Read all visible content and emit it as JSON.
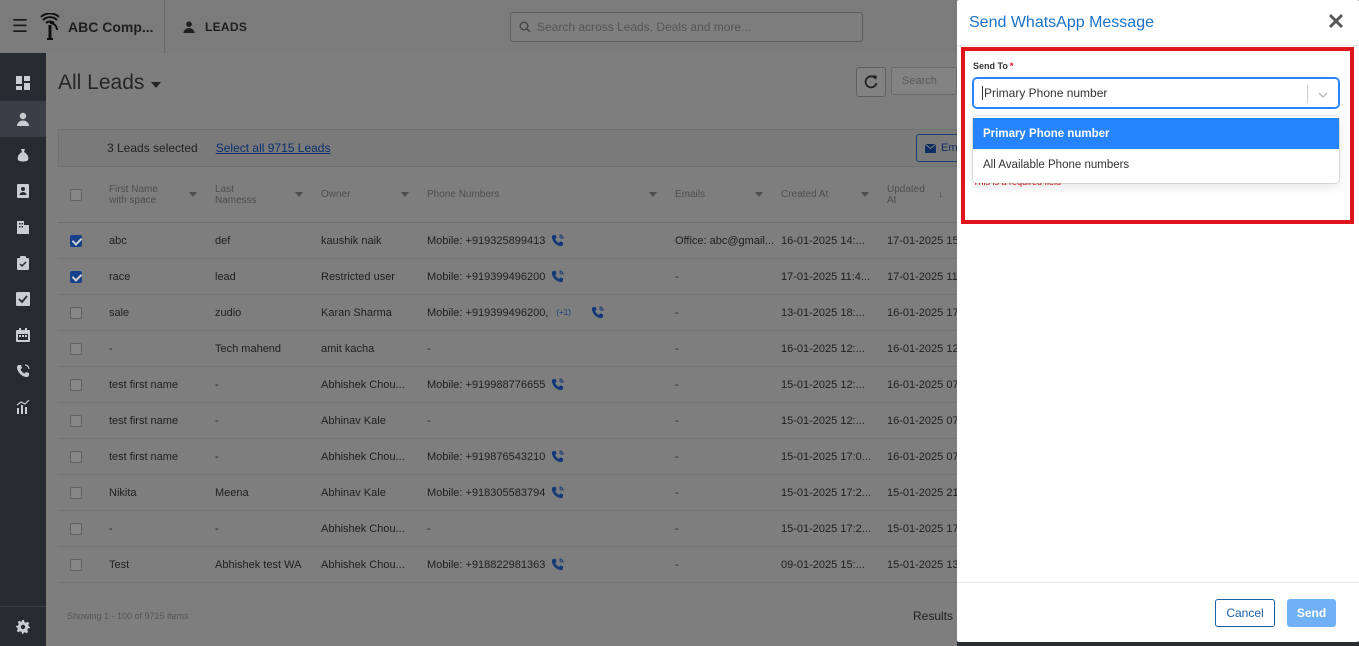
{
  "topbar": {
    "company": "ABC Comp...",
    "module": "LEADS",
    "search_placeholder": "Search across Leads, Deals and more..."
  },
  "sidebar": {
    "items": [
      "dashboard-icon",
      "user-icon",
      "money-bag-icon",
      "contact-card-icon",
      "building-icon",
      "clipboard-icon",
      "checkbox-icon",
      "calendar-icon",
      "phone-icon",
      "report-icon"
    ],
    "active": "user-icon",
    "settings": "gear-icon"
  },
  "page": {
    "title": "All Leads",
    "search_placeholder": "Search"
  },
  "selection": {
    "count_text": "3 Leads selected",
    "select_all": "Select all 9715 Leads",
    "email_button": "Em"
  },
  "table": {
    "headers": [
      "First Name with space",
      "Last Namesss",
      "Owner",
      "Phone Numbers",
      "Emails",
      "Created At",
      "Updated At"
    ],
    "rows": [
      {
        "checked": true,
        "first": "abc",
        "last": "def",
        "owner": "kaushik naik",
        "phone": "Mobile: +919325899413",
        "more": "",
        "call": true,
        "email": "Office: abc@gmail...",
        "created": "16-01-2025 14:...",
        "updated": "17-01-2025 15"
      },
      {
        "checked": true,
        "first": "race",
        "last": "lead",
        "owner": "Restricted user",
        "phone": "Mobile: +919399496200",
        "more": "",
        "call": true,
        "email": "-",
        "created": "17-01-2025 11:4...",
        "updated": "17-01-2025 11"
      },
      {
        "checked": false,
        "first": "sale",
        "last": "zudio",
        "owner": "Karan Sharma",
        "phone": "Mobile: +919399496200,",
        "more": "(+1)",
        "call": true,
        "email": "-",
        "created": "13-01-2025 18:...",
        "updated": "16-01-2025 17"
      },
      {
        "checked": false,
        "first": "-",
        "last": "Tech mahend",
        "owner": "amit kacha",
        "phone": "-",
        "more": "",
        "call": false,
        "email": "-",
        "created": "16-01-2025 12:...",
        "updated": "16-01-2025 12"
      },
      {
        "checked": false,
        "first": "test first name",
        "last": "-",
        "owner": "Abhishek Chou...",
        "phone": "Mobile: +919988776655",
        "more": "",
        "call": true,
        "email": "-",
        "created": "15-01-2025 12:...",
        "updated": "16-01-2025 07"
      },
      {
        "checked": false,
        "first": "test first name",
        "last": "-",
        "owner": "Abhinav Kale",
        "phone": "-",
        "more": "",
        "call": false,
        "email": "-",
        "created": "15-01-2025 12:...",
        "updated": "16-01-2025 07"
      },
      {
        "checked": false,
        "first": "test first name",
        "last": "-",
        "owner": "Abhishek Chou...",
        "phone": "Mobile: +919876543210",
        "more": "",
        "call": true,
        "email": "-",
        "created": "15-01-2025 17:0...",
        "updated": "16-01-2025 07"
      },
      {
        "checked": false,
        "first": "Nikita",
        "last": "Meena",
        "owner": "Abhinav Kale",
        "phone": "Mobile: +918305583794",
        "more": "",
        "call": true,
        "email": "-",
        "created": "15-01-2025 17:2...",
        "updated": "15-01-2025 21"
      },
      {
        "checked": false,
        "first": "-",
        "last": "-",
        "owner": "Abhishek Chou...",
        "phone": "-",
        "more": "",
        "call": false,
        "email": "-",
        "created": "15-01-2025 17:2...",
        "updated": "15-01-2025 17"
      },
      {
        "checked": false,
        "first": "Test",
        "last": "Abhishek test WA",
        "owner": "Abhishek Chou...",
        "phone": "Mobile: +918822981363",
        "more": "",
        "call": true,
        "email": "-",
        "created": "09-01-2025 15:...",
        "updated": "15-01-2025 13"
      }
    ]
  },
  "footer": {
    "showing": "Showing 1 - 100 of 9715 items",
    "results": "Results"
  },
  "modal": {
    "title": "Send WhatsApp Message",
    "field_label": "Send To",
    "required_mark": "*",
    "selected_value": "Primary Phone number",
    "options": [
      "Primary Phone number",
      "All Available Phone numbers"
    ],
    "error_text": "This is a required field",
    "cancel_label": "Cancel",
    "send_label": "Send",
    "highlight_color": "#e0141b",
    "accent_color": "#1a73c9"
  }
}
